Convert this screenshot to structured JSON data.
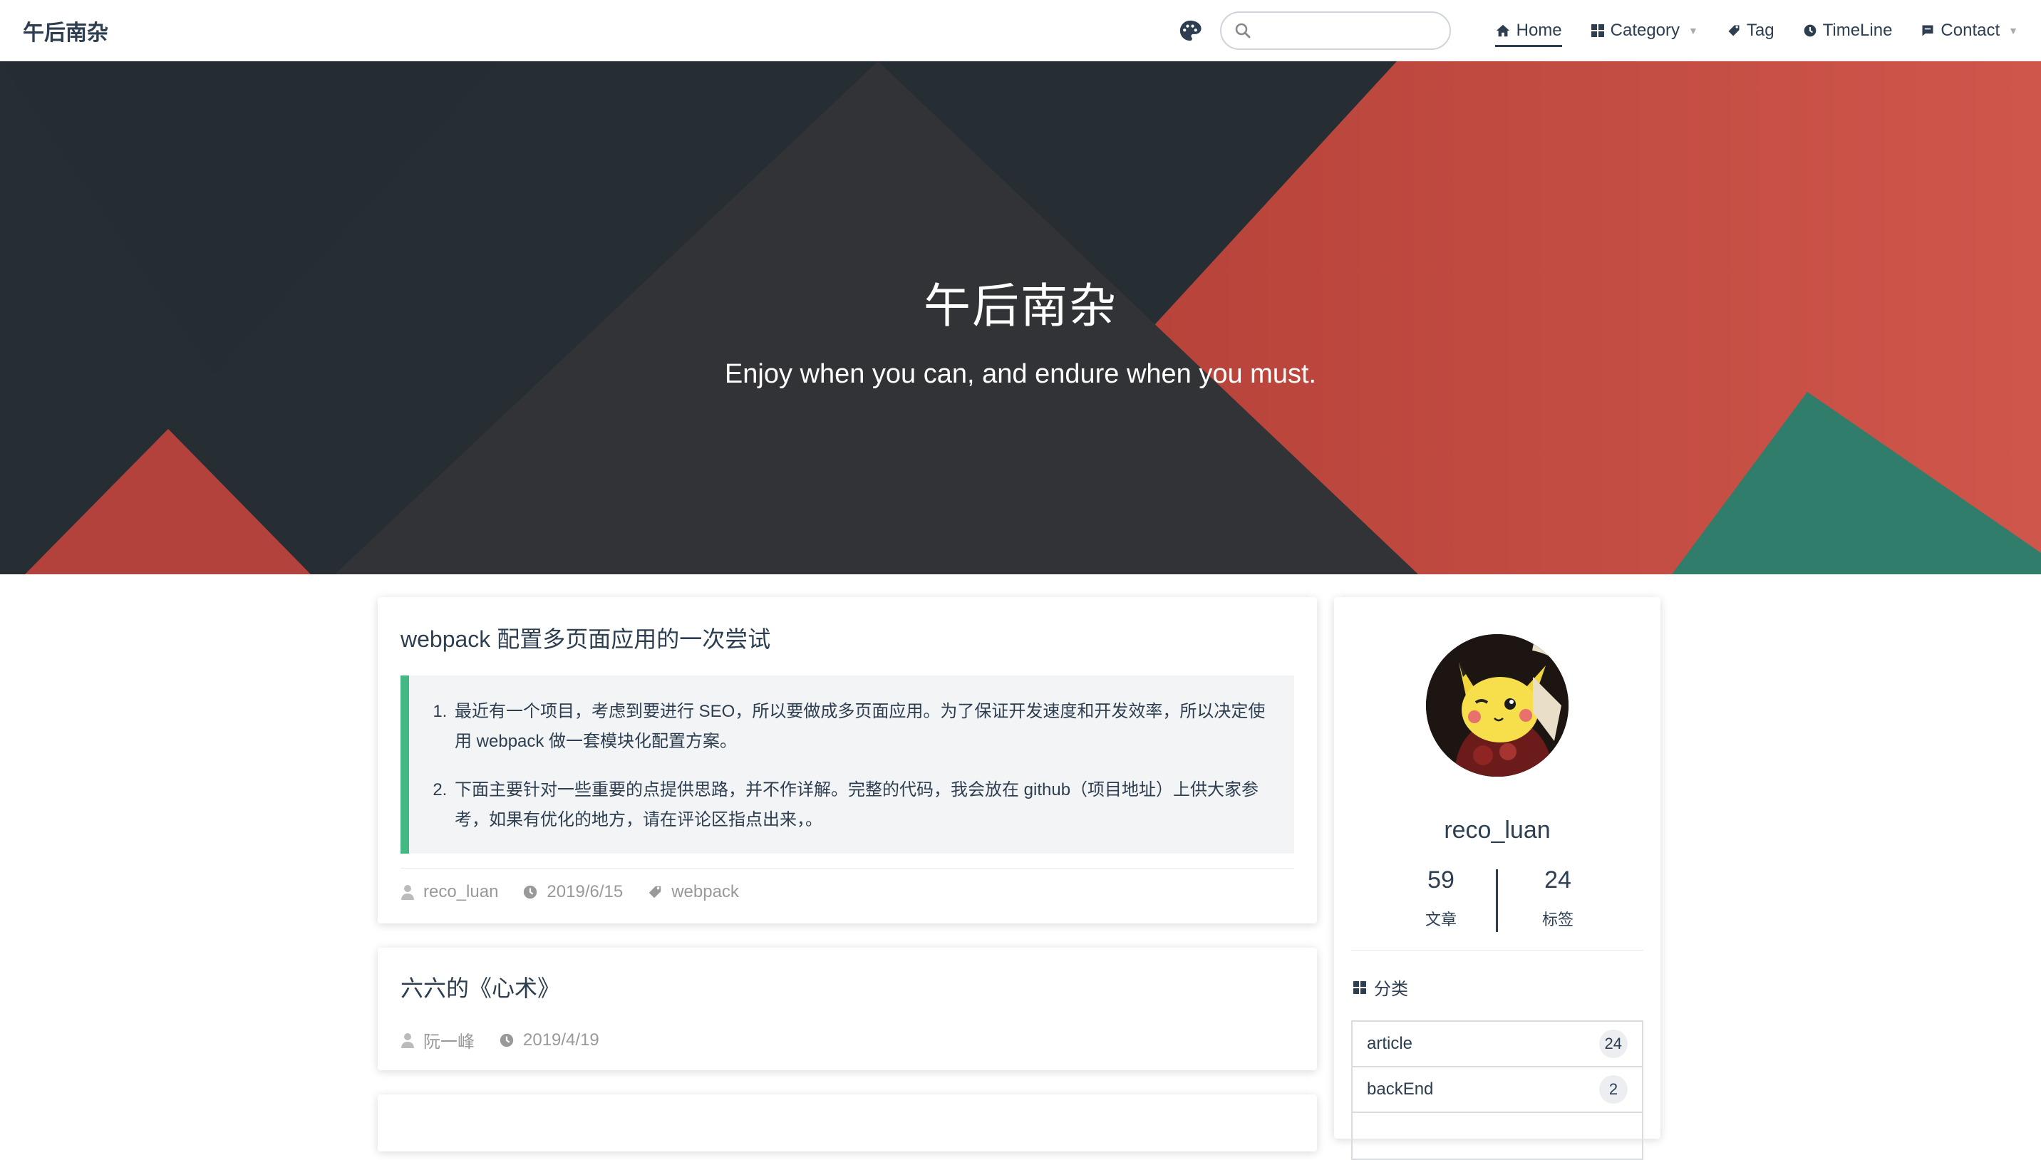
{
  "site": {
    "name": "午后南杂"
  },
  "nav": {
    "search_placeholder": "",
    "items": [
      {
        "label": "Home",
        "icon": "home-icon"
      },
      {
        "label": "Category",
        "icon": "grid-icon"
      },
      {
        "label": "Tag",
        "icon": "tag-icon"
      },
      {
        "label": "TimeLine",
        "icon": "clock-icon"
      },
      {
        "label": "Contact",
        "icon": "message-icon"
      }
    ]
  },
  "hero": {
    "title": "午后南杂",
    "subtitle": "Enjoy when you can, and endure when you must."
  },
  "colors": {
    "accent_green": "#42b983",
    "hero_dark": "#2b3037",
    "hero_red": "#c95147",
    "hero_teal": "#2f7d6a"
  },
  "posts": [
    {
      "title": "webpack 配置多页面应用的一次尝试",
      "excerpt": [
        "最近有一个项目，考虑到要进行 SEO，所以要做成多页面应用。为了保证开发速度和开发效率，所以决定使用 webpack 做一套模块化配置方案。",
        "下面主要针对一些重要的点提供思路，并不作详解。完整的代码，我会放在 github（项目地址）上供大家参考，如果有优化的地方，请在评论区指点出来，。"
      ],
      "author": "reco_luan",
      "date": "2019/6/15",
      "tag": "webpack"
    },
    {
      "title": "六六的《心术》",
      "author": "阮一峰",
      "date": "2019/4/19"
    }
  ],
  "sidebar": {
    "author": "reco_luan",
    "stats": [
      {
        "num": "59",
        "label": "文章"
      },
      {
        "num": "24",
        "label": "标签"
      }
    ],
    "category_heading": "分类",
    "categories": [
      {
        "name": "article",
        "count": "24"
      },
      {
        "name": "backEnd",
        "count": "2"
      },
      {
        "name": "",
        "count": ""
      }
    ]
  }
}
